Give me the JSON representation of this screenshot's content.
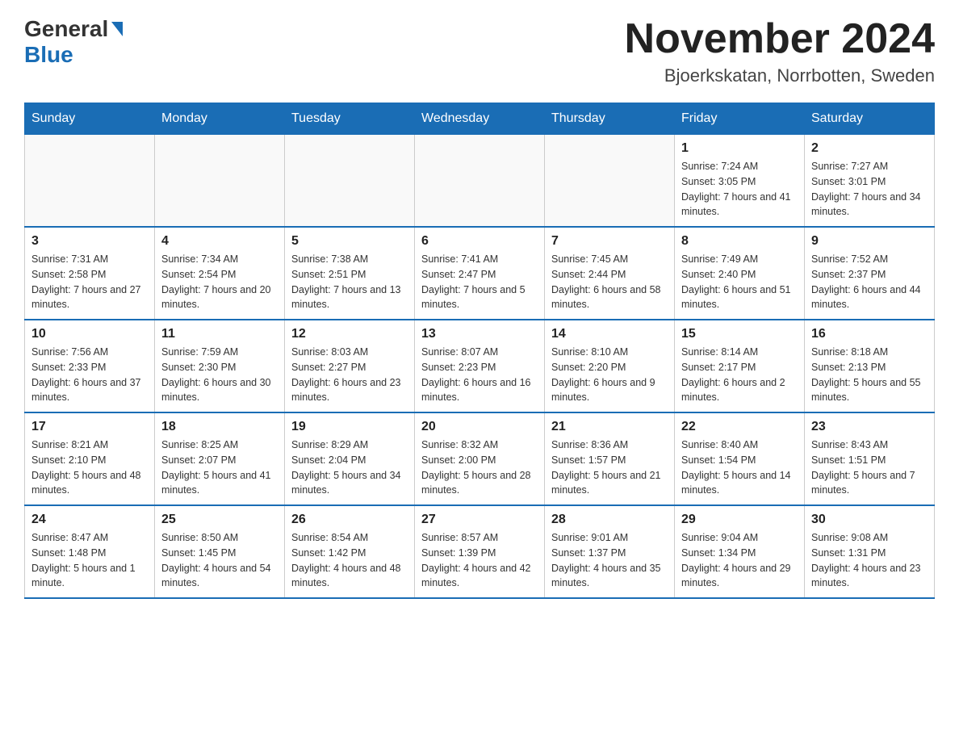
{
  "header": {
    "logo_general": "General",
    "logo_blue": "Blue",
    "month_title": "November 2024",
    "location": "Bjoerkskatan, Norrbotten, Sweden"
  },
  "days_of_week": [
    "Sunday",
    "Monday",
    "Tuesday",
    "Wednesday",
    "Thursday",
    "Friday",
    "Saturday"
  ],
  "weeks": [
    [
      {
        "day": "",
        "info": ""
      },
      {
        "day": "",
        "info": ""
      },
      {
        "day": "",
        "info": ""
      },
      {
        "day": "",
        "info": ""
      },
      {
        "day": "",
        "info": ""
      },
      {
        "day": "1",
        "info": "Sunrise: 7:24 AM\nSunset: 3:05 PM\nDaylight: 7 hours and 41 minutes."
      },
      {
        "day": "2",
        "info": "Sunrise: 7:27 AM\nSunset: 3:01 PM\nDaylight: 7 hours and 34 minutes."
      }
    ],
    [
      {
        "day": "3",
        "info": "Sunrise: 7:31 AM\nSunset: 2:58 PM\nDaylight: 7 hours and 27 minutes."
      },
      {
        "day": "4",
        "info": "Sunrise: 7:34 AM\nSunset: 2:54 PM\nDaylight: 7 hours and 20 minutes."
      },
      {
        "day": "5",
        "info": "Sunrise: 7:38 AM\nSunset: 2:51 PM\nDaylight: 7 hours and 13 minutes."
      },
      {
        "day": "6",
        "info": "Sunrise: 7:41 AM\nSunset: 2:47 PM\nDaylight: 7 hours and 5 minutes."
      },
      {
        "day": "7",
        "info": "Sunrise: 7:45 AM\nSunset: 2:44 PM\nDaylight: 6 hours and 58 minutes."
      },
      {
        "day": "8",
        "info": "Sunrise: 7:49 AM\nSunset: 2:40 PM\nDaylight: 6 hours and 51 minutes."
      },
      {
        "day": "9",
        "info": "Sunrise: 7:52 AM\nSunset: 2:37 PM\nDaylight: 6 hours and 44 minutes."
      }
    ],
    [
      {
        "day": "10",
        "info": "Sunrise: 7:56 AM\nSunset: 2:33 PM\nDaylight: 6 hours and 37 minutes."
      },
      {
        "day": "11",
        "info": "Sunrise: 7:59 AM\nSunset: 2:30 PM\nDaylight: 6 hours and 30 minutes."
      },
      {
        "day": "12",
        "info": "Sunrise: 8:03 AM\nSunset: 2:27 PM\nDaylight: 6 hours and 23 minutes."
      },
      {
        "day": "13",
        "info": "Sunrise: 8:07 AM\nSunset: 2:23 PM\nDaylight: 6 hours and 16 minutes."
      },
      {
        "day": "14",
        "info": "Sunrise: 8:10 AM\nSunset: 2:20 PM\nDaylight: 6 hours and 9 minutes."
      },
      {
        "day": "15",
        "info": "Sunrise: 8:14 AM\nSunset: 2:17 PM\nDaylight: 6 hours and 2 minutes."
      },
      {
        "day": "16",
        "info": "Sunrise: 8:18 AM\nSunset: 2:13 PM\nDaylight: 5 hours and 55 minutes."
      }
    ],
    [
      {
        "day": "17",
        "info": "Sunrise: 8:21 AM\nSunset: 2:10 PM\nDaylight: 5 hours and 48 minutes."
      },
      {
        "day": "18",
        "info": "Sunrise: 8:25 AM\nSunset: 2:07 PM\nDaylight: 5 hours and 41 minutes."
      },
      {
        "day": "19",
        "info": "Sunrise: 8:29 AM\nSunset: 2:04 PM\nDaylight: 5 hours and 34 minutes."
      },
      {
        "day": "20",
        "info": "Sunrise: 8:32 AM\nSunset: 2:00 PM\nDaylight: 5 hours and 28 minutes."
      },
      {
        "day": "21",
        "info": "Sunrise: 8:36 AM\nSunset: 1:57 PM\nDaylight: 5 hours and 21 minutes."
      },
      {
        "day": "22",
        "info": "Sunrise: 8:40 AM\nSunset: 1:54 PM\nDaylight: 5 hours and 14 minutes."
      },
      {
        "day": "23",
        "info": "Sunrise: 8:43 AM\nSunset: 1:51 PM\nDaylight: 5 hours and 7 minutes."
      }
    ],
    [
      {
        "day": "24",
        "info": "Sunrise: 8:47 AM\nSunset: 1:48 PM\nDaylight: 5 hours and 1 minute."
      },
      {
        "day": "25",
        "info": "Sunrise: 8:50 AM\nSunset: 1:45 PM\nDaylight: 4 hours and 54 minutes."
      },
      {
        "day": "26",
        "info": "Sunrise: 8:54 AM\nSunset: 1:42 PM\nDaylight: 4 hours and 48 minutes."
      },
      {
        "day": "27",
        "info": "Sunrise: 8:57 AM\nSunset: 1:39 PM\nDaylight: 4 hours and 42 minutes."
      },
      {
        "day": "28",
        "info": "Sunrise: 9:01 AM\nSunset: 1:37 PM\nDaylight: 4 hours and 35 minutes."
      },
      {
        "day": "29",
        "info": "Sunrise: 9:04 AM\nSunset: 1:34 PM\nDaylight: 4 hours and 29 minutes."
      },
      {
        "day": "30",
        "info": "Sunrise: 9:08 AM\nSunset: 1:31 PM\nDaylight: 4 hours and 23 minutes."
      }
    ]
  ]
}
